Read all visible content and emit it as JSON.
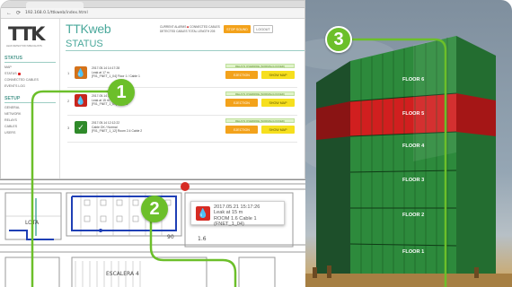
{
  "browser": {
    "url": "192.168.0.1/ttkweb/index.html"
  },
  "app": {
    "logo": "TTK",
    "logo_sub": "LEAK DETECTION SPECIALISTS",
    "brand": "TTKweb",
    "header": {
      "line1_prefix": "CURRENT ALARMS",
      "line1_alarm": "■",
      "line1_suffix": "CONNECTED CABLES",
      "line2": "DETECTED CABLES   TOTAL LENGTH 205"
    },
    "stop_sound": "STOP SOUND",
    "logout": "LOGOUT",
    "status_title": "STATUS"
  },
  "sidebar": {
    "sections": [
      {
        "title": "STATUS",
        "items": [
          {
            "label": "MAP",
            "alarm": false
          },
          {
            "label": "STATUS",
            "alarm": true
          },
          {
            "label": "CONNECTED CABLES",
            "alarm": false
          },
          {
            "label": "EVENTS LOG",
            "alarm": false
          }
        ]
      },
      {
        "title": "SETUP",
        "items": [
          {
            "label": "GENERAL",
            "alarm": false
          },
          {
            "label": "NETWORK",
            "alarm": false
          },
          {
            "label": "RELAYS",
            "alarm": false
          },
          {
            "label": "CABLES",
            "alarm": false
          },
          {
            "label": "USERS",
            "alarm": false
          }
        ]
      }
    ]
  },
  "events": [
    {
      "num": "1",
      "icon": "💧",
      "color": "#d4721a",
      "line1": "2017.05.14  14:17:28",
      "line2": "Leak at 17 m",
      "line3": "[F01_FNET_1_04] Floor 1 / Cable 1",
      "relays": "RELAYS OVERRIDE (NORMAL/LOCKED)",
      "eject": "EJECTION",
      "map": "SHOW MAP"
    },
    {
      "num": "2",
      "icon": "💧",
      "color": "#c8261d",
      "line1": "2017.05.14  14:12:03",
      "line2": "Leak at 15 m",
      "line3": "[F01_FNET_1_04] Cable 1",
      "relays": "RELAYS OVERRIDE (NORMAL/LOCKED)",
      "eject": "EJECTION",
      "map": "SHOW MAP"
    },
    {
      "num": "3",
      "icon": "✓",
      "color": "#2f8a2a",
      "line1": "2017.05.14  12:12:22",
      "line2": "Cable OK / Normal",
      "line3": "[F01_FNET_1_12] Room 2.4 Cable 2",
      "relays": "RELAYS OVERRIDE (NORMAL/LOCKED)",
      "eject": "EJECTION",
      "map": "SHOW MAP"
    }
  ],
  "plan": {
    "popup": {
      "line1": "2017.05.21  15:17:26",
      "line2": "Leak at 15 m",
      "line3": "ROOM 1.6 Cable 1 (FNET_1_04)"
    },
    "room_label": "LOTA",
    "distance": "90",
    "stairs_label": "ESCALERA  4",
    "room_code": "1.6"
  },
  "building": {
    "floors": [
      "FLOOR 6",
      "FLOOR 5",
      "FLOOR 4",
      "FLOOR 3",
      "FLOOR 2",
      "FLOOR 1"
    ],
    "alarm_floor": "FLOOR 5",
    "alarm_color": "#d11f1f",
    "normal_color": "#2d8a3c"
  },
  "markers": [
    "1",
    "2",
    "3"
  ],
  "colors": {
    "accent": "#4aa89b",
    "marker": "#6cbf2a",
    "orange_button": "#f3a21b",
    "yellow_button": "#f6df1e",
    "alarm_red": "#d22b23"
  }
}
